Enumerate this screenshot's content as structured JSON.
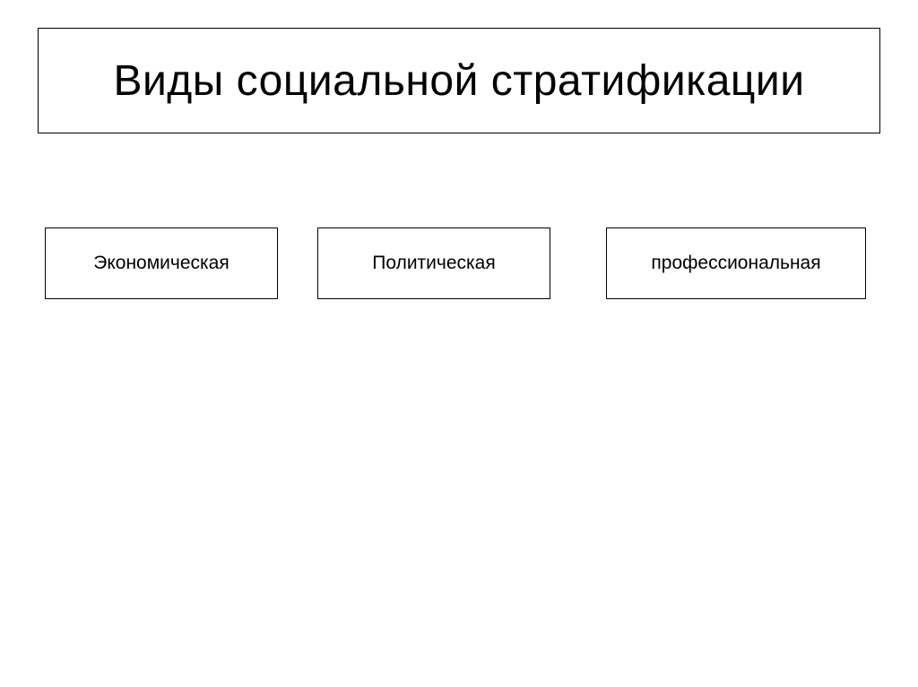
{
  "title": "Виды социальной стратификации",
  "categories": [
    "Экономическая",
    "Политическая",
    "профессиональная"
  ]
}
